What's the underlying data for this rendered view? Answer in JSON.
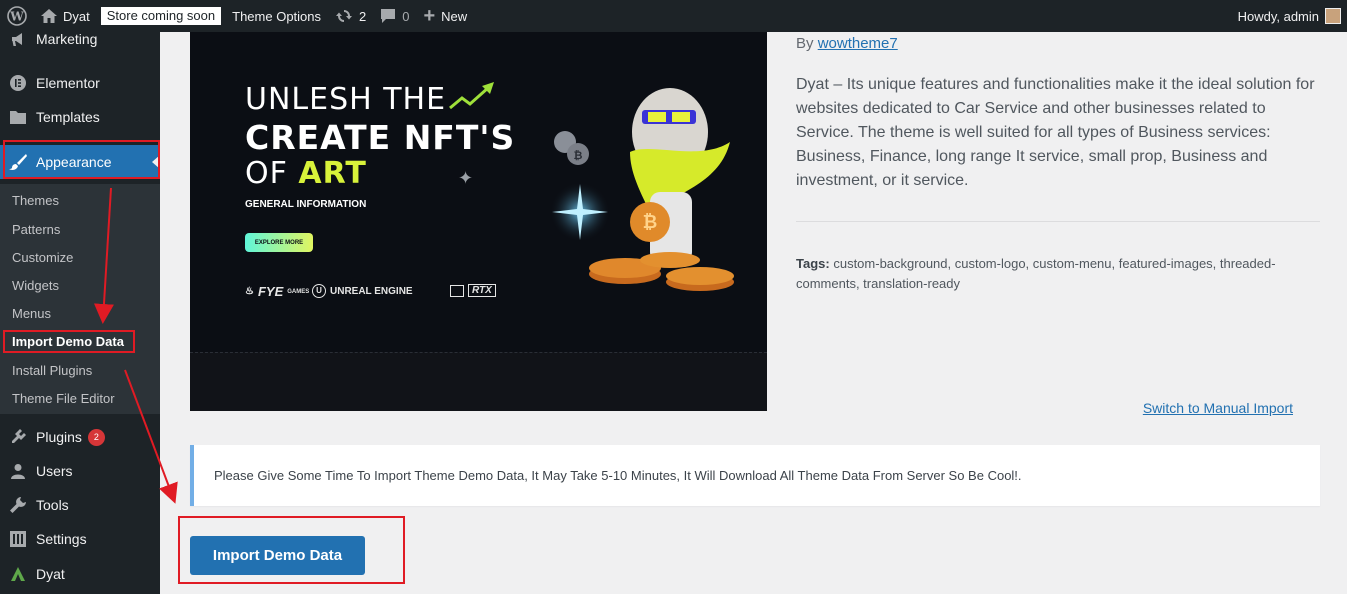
{
  "adminbar": {
    "site_name": "Dyat",
    "store_badge": "Store coming soon",
    "theme_options": "Theme Options",
    "updates_count": "2",
    "comments_count": "0",
    "new_label": "New",
    "howdy": "Howdy, admin"
  },
  "sidebar": {
    "items": [
      {
        "label": "Marketing",
        "icon": "megaphone-icon"
      },
      {
        "label": "Elementor",
        "icon": "elementor-icon"
      },
      {
        "label": "Templates",
        "icon": "folder-icon"
      },
      {
        "label": "Appearance",
        "icon": "paintbrush-icon"
      },
      {
        "label": "Plugins",
        "icon": "plugin-icon",
        "badge": "2"
      },
      {
        "label": "Users",
        "icon": "user-icon"
      },
      {
        "label": "Tools",
        "icon": "wrench-icon"
      },
      {
        "label": "Settings",
        "icon": "settings-icon"
      },
      {
        "label": "Dyat",
        "icon": "dyat-logo-icon"
      }
    ],
    "submenu": [
      "Themes",
      "Patterns",
      "Customize",
      "Widgets",
      "Menus",
      "Import Demo Data",
      "Install Plugins",
      "Theme File Editor"
    ]
  },
  "preview": {
    "line1": "UNLESH THE",
    "line2": "CREATE NFT'S",
    "line3_a": "OF ",
    "line3_b": "ART",
    "general": "GENERAL INFORMATION",
    "explore": "EXPLORE MORE",
    "brand1": "FYE",
    "brand1_sub": "GAMES",
    "brand2": "UNREAL ENGINE",
    "brand3": "RTX"
  },
  "theme": {
    "by": "By",
    "author": "wowtheme7",
    "description": "Dyat – Its unique features and functionalities make it the ideal solution for websites dedicated to Car Service and other businesses related to Service. The theme is well suited for all types of Business services: Business, Finance, long range It service, small prop, Business and investment, or it service.",
    "tags_label": "Tags:",
    "tags": "custom-background, custom-logo, custom-menu, featured-images, threaded-comments, translation-ready",
    "manual_link": "Switch to Manual Import"
  },
  "notice": "Please Give Some Time To Import Theme Demo Data, It May Take 5-10 Minutes, It Will Download All Theme Data From Server So Be Cool!.",
  "import_button": "Import Demo Data",
  "colors": {
    "admin_dark": "#1d2327",
    "accent_blue": "#2271b1",
    "annotation_red": "#e01b24"
  }
}
